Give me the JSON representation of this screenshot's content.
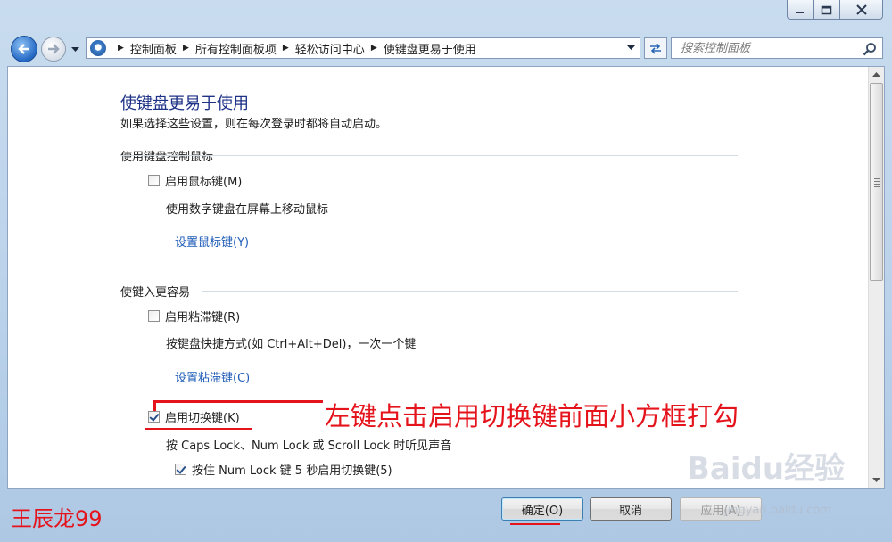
{
  "breadcrumb": {
    "items": [
      "控制面板",
      "所有控制面板项",
      "轻松访问中心",
      "使键盘更易于使用"
    ]
  },
  "search": {
    "placeholder": "搜索控制面板"
  },
  "page": {
    "title": "使键盘更易于使用",
    "subtitle": "如果选择这些设置，则在每次登录时都将自动启动。"
  },
  "sections": {
    "mouse": {
      "heading": "使用键盘控制鼠标",
      "checkbox_label": "启用鼠标键(M)",
      "checked": false,
      "description": "使用数字键盘在屏幕上移动鼠标",
      "link": "设置鼠标键(Y)"
    },
    "typing": {
      "heading": "使键入更容易",
      "sticky_label": "启用粘滞键(R)",
      "sticky_checked": false,
      "sticky_description": "按键盘快捷方式(如 Ctrl+Alt+Del)，一次一个键",
      "sticky_link": "设置粘滞键(C)",
      "toggle_label": "启用切换键(K)",
      "toggle_checked": true,
      "toggle_description": "按 Caps Lock、Num Lock 或 Scroll Lock 时听见声音",
      "numlock_label": "按住 Num Lock 键 5 秒启用切换键(5)",
      "numlock_checked": true
    }
  },
  "buttons": {
    "ok": "确定(O)",
    "cancel": "取消",
    "apply": "应用(A)"
  },
  "annotation": {
    "instruction": "左键点击启用切换键前面小方框打勾",
    "author": "王辰龙99",
    "watermark": "Baidu经验",
    "watermark_url": "jingyan.baidu.com"
  },
  "colors": {
    "annotation": "#e5141c",
    "link": "#1f5cb8",
    "title": "#1e3287"
  }
}
